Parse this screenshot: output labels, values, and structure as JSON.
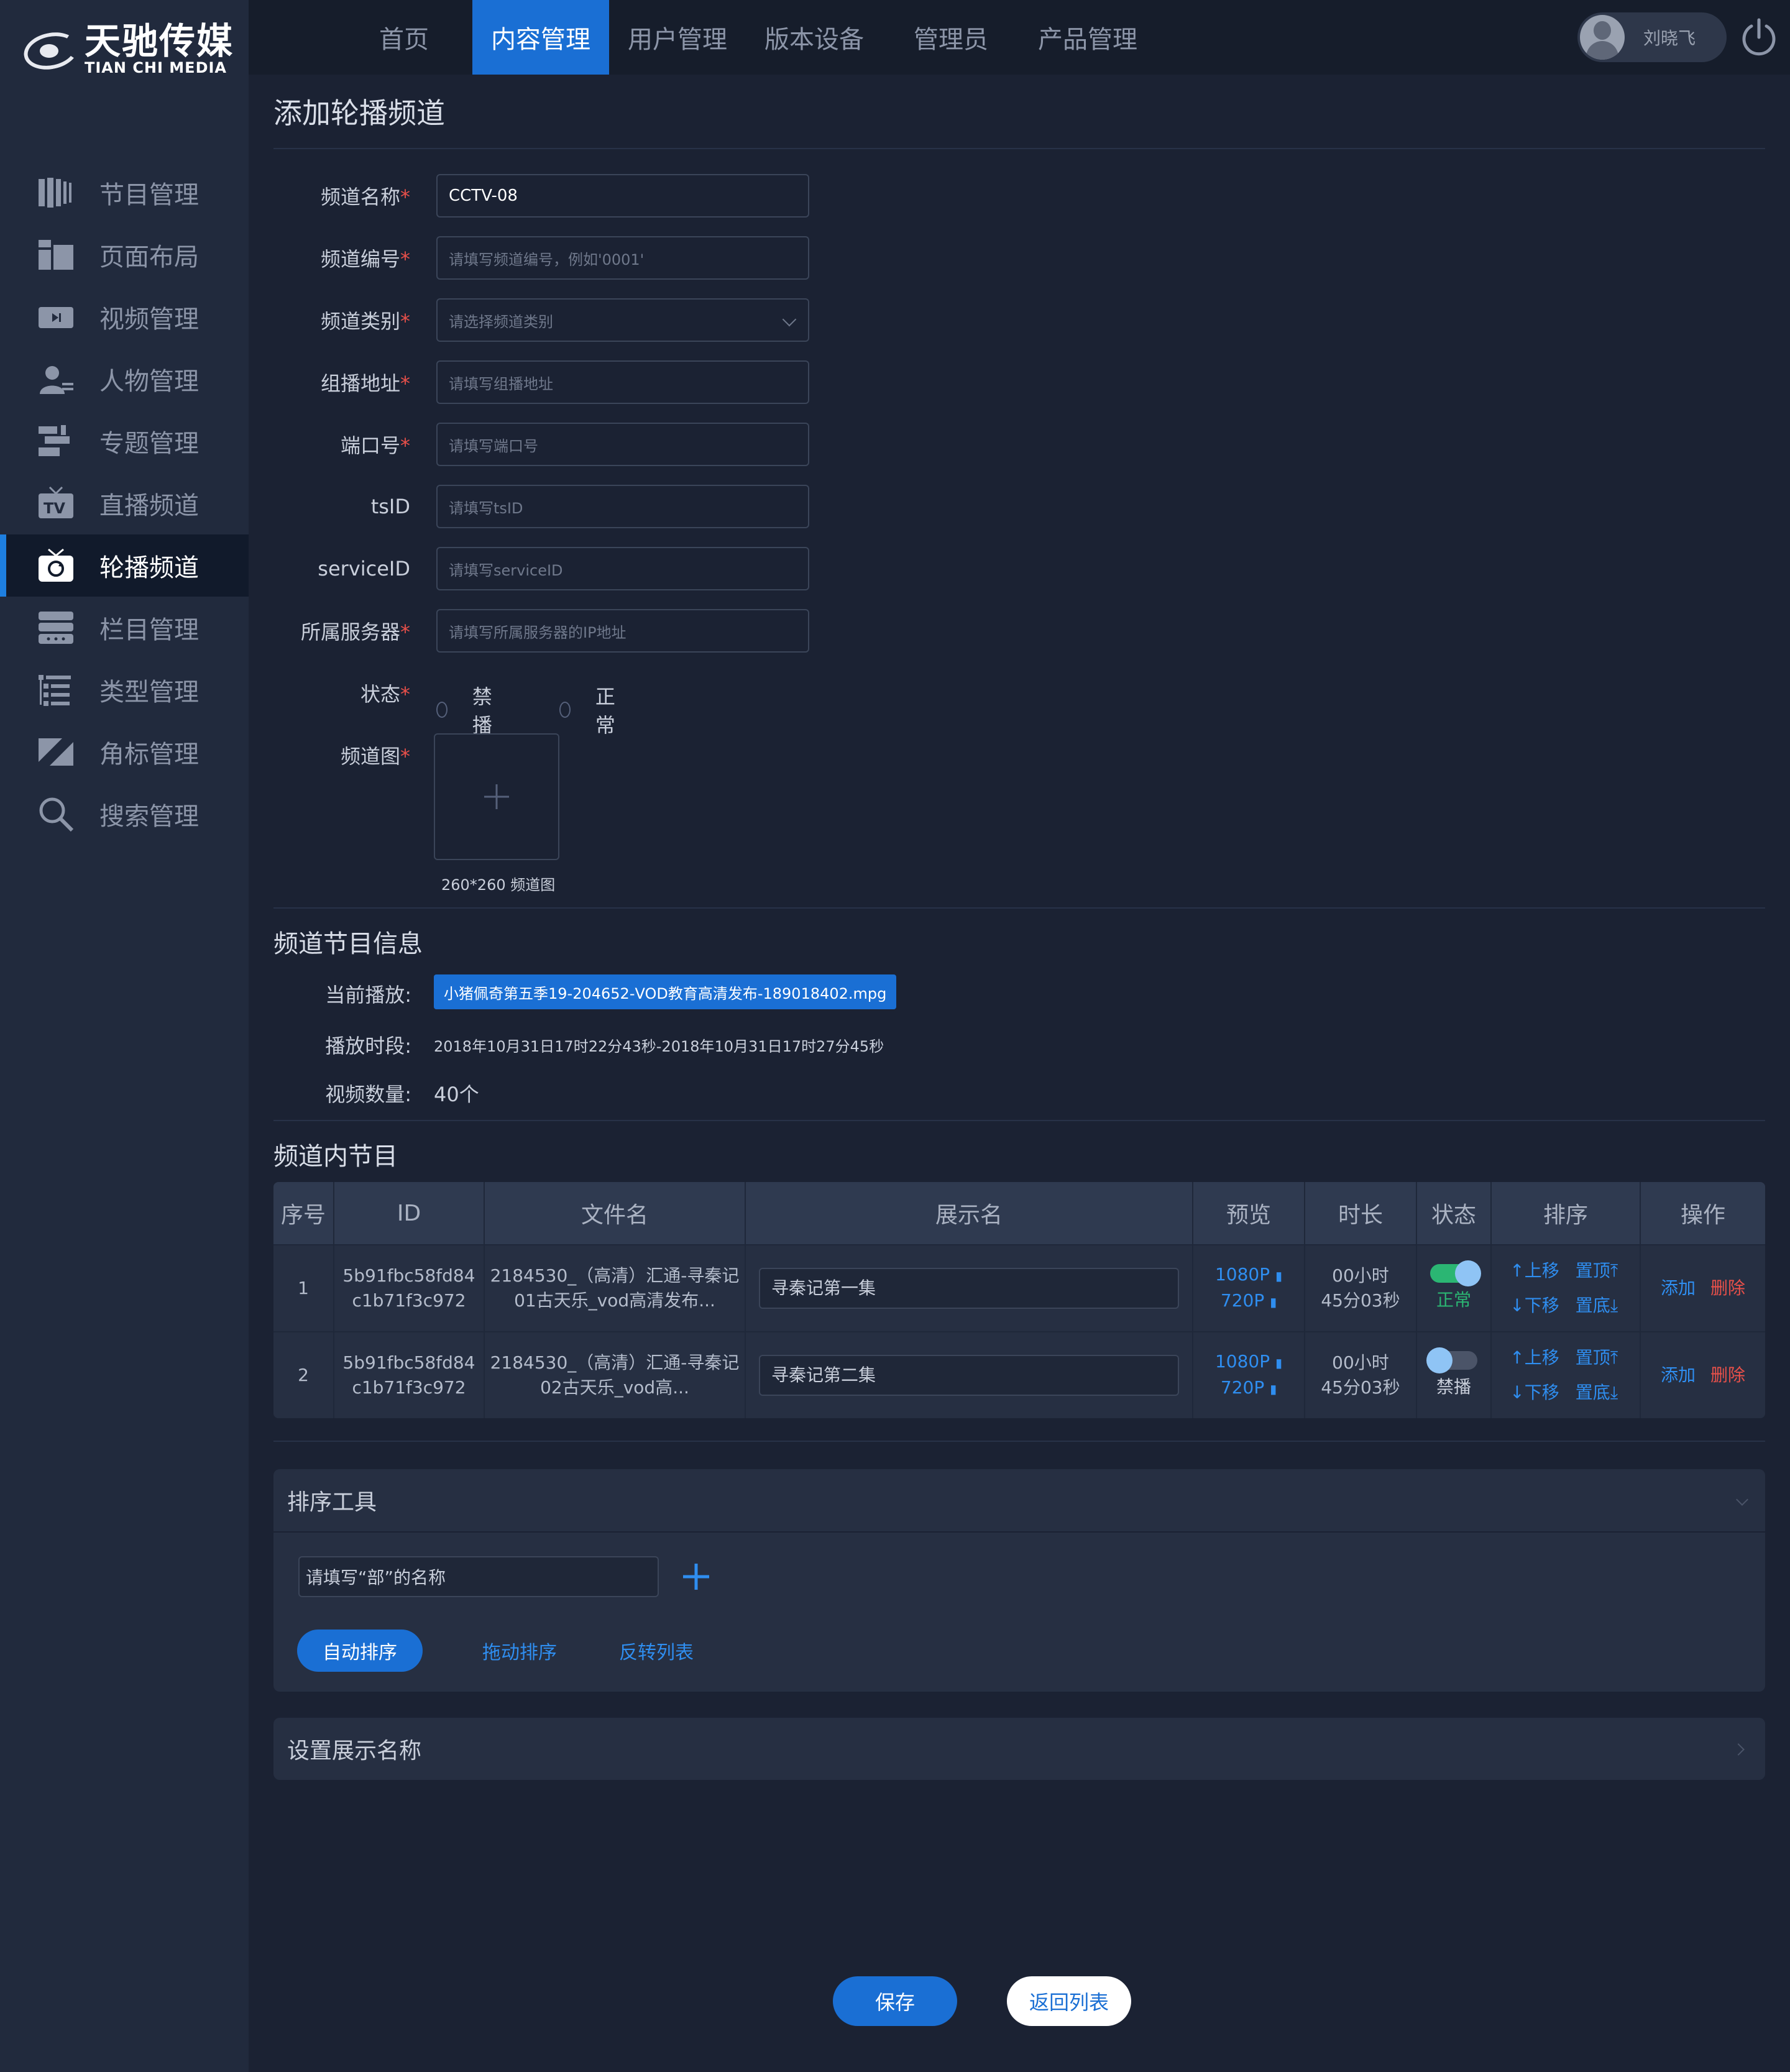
{
  "brand": {
    "name_cn": "天驰传媒",
    "name_en": "TIAN CHI MEDIA"
  },
  "top_tabs": [
    {
      "label": "首页",
      "active": false
    },
    {
      "label": "内容管理",
      "active": true
    },
    {
      "label": "用户管理",
      "active": false
    },
    {
      "label": "版本设备",
      "active": false
    },
    {
      "label": "管理员",
      "active": false
    },
    {
      "label": "产品管理",
      "active": false
    }
  ],
  "user": {
    "name": "刘晓飞"
  },
  "sidebar": {
    "items": [
      {
        "label": "节目管理",
        "icon": "program-icon",
        "active": false
      },
      {
        "label": "页面布局",
        "icon": "layout-icon",
        "active": false
      },
      {
        "label": "视频管理",
        "icon": "video-icon",
        "active": false
      },
      {
        "label": "人物管理",
        "icon": "people-icon",
        "active": false
      },
      {
        "label": "专题管理",
        "icon": "topic-icon",
        "active": false
      },
      {
        "label": "直播频道",
        "icon": "tv-icon",
        "active": false
      },
      {
        "label": "轮播频道",
        "icon": "carousel-tv-icon",
        "active": true
      },
      {
        "label": "栏目管理",
        "icon": "column-icon",
        "active": false
      },
      {
        "label": "类型管理",
        "icon": "type-icon",
        "active": false
      },
      {
        "label": "角标管理",
        "icon": "corner-mark-icon",
        "active": false
      },
      {
        "label": "搜索管理",
        "icon": "search-icon",
        "active": false
      }
    ]
  },
  "page": {
    "title": "添加轮播频道"
  },
  "form": {
    "channel_name": {
      "label": "频道名称",
      "required": true,
      "value": "CCTV-08"
    },
    "channel_code": {
      "label": "频道编号",
      "required": true,
      "placeholder": "请填写频道编号，例如'0001'"
    },
    "channel_type": {
      "label": "频道类别",
      "required": true,
      "placeholder": "请选择频道类别"
    },
    "multicast": {
      "label": "组播地址",
      "required": true,
      "placeholder": "请填写组播地址"
    },
    "port": {
      "label": "端口号",
      "required": true,
      "placeholder": "请填写端口号"
    },
    "tsid": {
      "label": "tsID",
      "required": false,
      "placeholder": "请填写tsID"
    },
    "serviceid": {
      "label": "serviceID",
      "required": false,
      "placeholder": "请填写serviceID"
    },
    "server": {
      "label": "所属服务器",
      "required": true,
      "placeholder": "请填写所属服务器的IP地址"
    },
    "status": {
      "label": "状态",
      "required": true,
      "options": [
        "禁播",
        "正常"
      ]
    },
    "image": {
      "label": "频道图",
      "required": true,
      "hint": "260*260 频道图"
    },
    "required_mark": "*"
  },
  "program_info": {
    "title": "频道节目信息",
    "current_label": "当前播放:",
    "current_file": "小猪佩奇第五季19-204652-VOD教育高清发布-189018402.mpg",
    "period_label": "播放时段:",
    "period": "2018年10月31日17时22分43秒-2018年10月31日17时27分45秒",
    "count_label": "视频数量:",
    "count": "40个"
  },
  "programs_table": {
    "title": "频道内节目",
    "columns": [
      "序号",
      "ID",
      "文件名",
      "展示名",
      "预览",
      "时长",
      "状态",
      "排序",
      "操作"
    ],
    "rows": [
      {
        "index": "1",
        "id_line1": "5b91fbc58fd84",
        "id_line2": "c1b71f3c972",
        "file_line1": "2184530_（高清）汇通-寻秦记",
        "file_line2": "01古天乐_vod高清发布...",
        "display_name": "寻秦记第一集",
        "preview_hd": "1080P",
        "preview_sd": "720P",
        "duration_line1": "00小时",
        "duration_line2": "45分03秒",
        "status_on": true,
        "status": "正常"
      },
      {
        "index": "2",
        "id_line1": "5b91fbc58fd84",
        "id_line2": "c1b71f3c972",
        "file_line1": "2184530_（高清）汇通-寻秦记",
        "file_line2": "02古天乐_vod高...",
        "display_name": "寻秦记第二集",
        "preview_hd": "1080P",
        "preview_sd": "720P",
        "duration_line1": "00小时",
        "duration_line2": "45分03秒",
        "status_on": false,
        "status": "禁播"
      }
    ],
    "sort_actions": {
      "up": "上移",
      "top": "置顶",
      "down": "下移",
      "bottom": "置底"
    },
    "row_actions": {
      "add": "添加",
      "delete": "删除"
    }
  },
  "sort_tool": {
    "title": "排序工具",
    "input_value": "请填写“部”的名称",
    "auto_sort": "自动排序",
    "drag_sort": "拖动排序",
    "reverse": "反转列表"
  },
  "display_name_panel": {
    "title": "设置展示名称"
  },
  "footer": {
    "save": "保存",
    "back": "返回列表"
  },
  "colors": {
    "accent": "#1a6fd4",
    "danger": "#e8504a",
    "success": "#2bb673"
  }
}
